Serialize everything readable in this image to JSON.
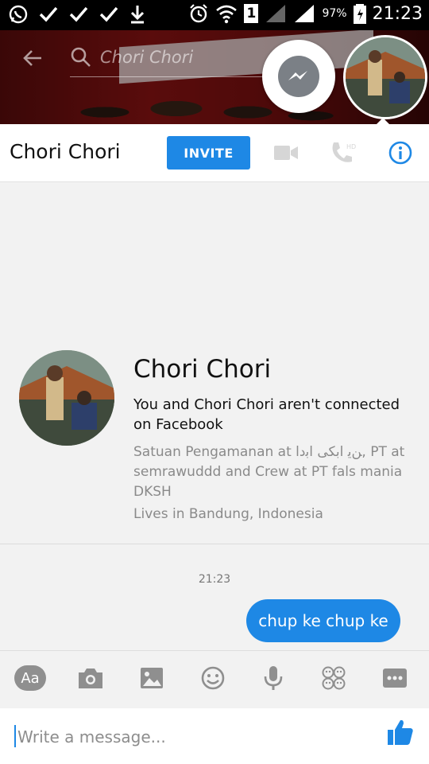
{
  "status_bar": {
    "battery_pct": "97%",
    "sim_label": "1",
    "time": "21:23",
    "icons": [
      "whatsapp-icon",
      "check-icon",
      "check-icon",
      "check-icon",
      "download-icon",
      "alarm-icon",
      "wifi-icon",
      "signal-icon",
      "signal-icon",
      "battery-icon"
    ]
  },
  "header": {
    "search_placeholder": "Chori Chori"
  },
  "titlebar": {
    "name": "Chori Chori",
    "invite_label": "INVITE"
  },
  "profile": {
    "name": "Chori Chori",
    "connection_text": "You and Chori Chori aren't connected on Facebook",
    "work_text": "Satuan Pengamanan at ﻦﻳ ﺍﺑﻜﯽ ﺍﺑﺩﺍ, PT at semrawuddd and Crew at PT fals mania DKSH",
    "lives_text": "Lives in Bandung, Indonesia"
  },
  "conversation": {
    "timestamp": "21:23",
    "messages": [
      {
        "text": "chup ke chup ke",
        "from": "me"
      }
    ]
  },
  "composer": {
    "aa_label": "Aa",
    "placeholder": "Write a message...",
    "tools": [
      "text-format-icon",
      "camera-icon",
      "gallery-icon",
      "emoji-icon",
      "microphone-icon",
      "stickers-icon",
      "more-icon"
    ]
  },
  "colors": {
    "accent": "#1e88e5",
    "status_bar_bg": "#000000",
    "muted_text": "#8a8a8a"
  }
}
